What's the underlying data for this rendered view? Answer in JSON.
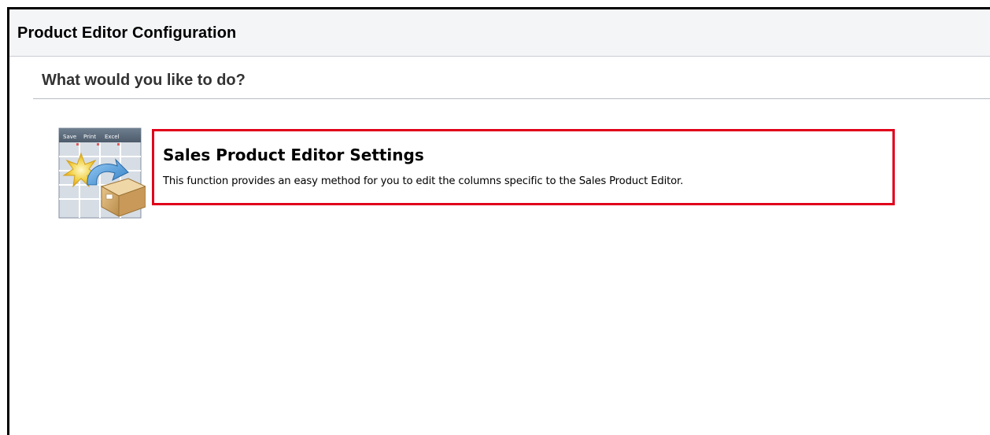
{
  "header": {
    "title": "Product Editor Configuration",
    "background_color": "#f4f5f7"
  },
  "main": {
    "question": "What would you like to do?",
    "options": [
      {
        "title": "Sales Product Editor Settings",
        "description": "This function provides an easy method for you to edit the columns specific to the Sales Product Editor.",
        "icon": "spreadsheet-with-box-and-arrow-icon",
        "icon_labels": [
          "Save",
          "Print",
          "Excel"
        ],
        "highlight_color": "#e0001a"
      }
    ]
  }
}
